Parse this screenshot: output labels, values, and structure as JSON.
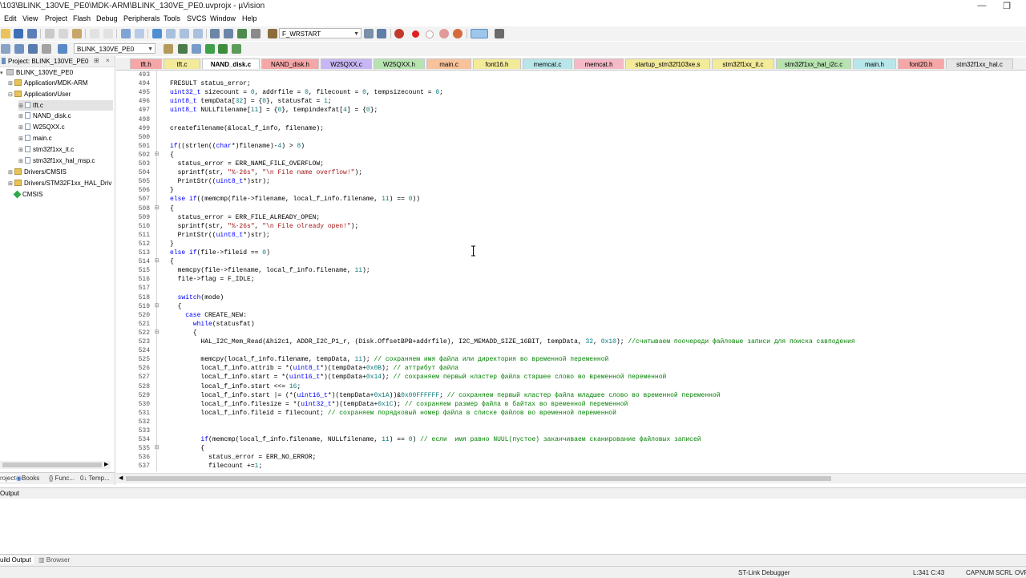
{
  "window": {
    "title": "\\103\\BLINK_130VE_PE0\\MDK-ARM\\BLINK_130VE_PE0.uvprojx - µVision",
    "minimize_glyph": "—",
    "restore_glyph": "❐"
  },
  "menu": [
    "Edit",
    "View",
    "Project",
    "Flash",
    "Debug",
    "Peripherals",
    "Tools",
    "SVCS",
    "Window",
    "Help"
  ],
  "toolbar": {
    "function_combo": "F_WRSTART",
    "target_combo": "BLINK_130VE_PE0"
  },
  "project": {
    "header": "Project: BLINK_130VE_PE0",
    "tree": [
      {
        "label": "BLINK_130VE_PE0",
        "level": 0,
        "type": "target",
        "expander": "▾"
      },
      {
        "label": "Application/MDK-ARM",
        "level": 1,
        "type": "folder",
        "expander": "⊞"
      },
      {
        "label": "Application/User",
        "level": 1,
        "type": "folder",
        "expander": "⊟"
      },
      {
        "label": "tft.c",
        "level": 2,
        "type": "file",
        "expander": "⊞"
      },
      {
        "label": "NAND_disk.c",
        "level": 2,
        "type": "file",
        "expander": "⊞"
      },
      {
        "label": "W25QXX.c",
        "level": 2,
        "type": "file",
        "expander": "⊞"
      },
      {
        "label": "main.c",
        "level": 2,
        "type": "file",
        "expander": "⊞"
      },
      {
        "label": "stm32f1xx_it.c",
        "level": 2,
        "type": "file",
        "expander": "⊞"
      },
      {
        "label": "stm32f1xx_hal_msp.c",
        "level": 2,
        "type": "file",
        "expander": "⊞"
      },
      {
        "label": "Drivers/CMSIS",
        "level": 1,
        "type": "folder",
        "expander": "⊞"
      },
      {
        "label": "Drivers/STM32F1xx_HAL_Driv",
        "level": 1,
        "type": "folder",
        "expander": "⊞"
      },
      {
        "label": "CMSIS",
        "level": 1,
        "type": "diamond",
        "expander": ""
      }
    ],
    "panel_tabs": [
      "roject",
      "Books",
      "{} Func...",
      "0↓ Temp..."
    ]
  },
  "editor_tabs": [
    {
      "label": "tft.h",
      "color": "#f5a6a6",
      "active": false
    },
    {
      "label": "tft.c",
      "color": "#f3ea9a",
      "active": false
    },
    {
      "label": "NAND_disk.c",
      "color": "#f3ea9a",
      "active": true
    },
    {
      "label": "NAND_disk.h",
      "color": "#f5a6a6",
      "active": false
    },
    {
      "label": "W25QXX.c",
      "color": "#c7b6f3",
      "active": false
    },
    {
      "label": "W25QXX.h",
      "color": "#b7e3b0",
      "active": false
    },
    {
      "label": "main.c",
      "color": "#f8c39a",
      "active": false
    },
    {
      "label": "font16.h",
      "color": "#f3ea9a",
      "active": false
    },
    {
      "label": "memcat.c",
      "color": "#b8e6ea",
      "active": false
    },
    {
      "label": "memcat.h",
      "color": "#f5b9c8",
      "active": false
    },
    {
      "label": "startup_stm32f103xe.s",
      "color": "#f3ea9a",
      "active": false
    },
    {
      "label": "stm32f1xx_it.c",
      "color": "#f3ea9a",
      "active": false
    },
    {
      "label": "stm32f1xx_hal_i2c.c",
      "color": "#b7e3b0",
      "active": false
    },
    {
      "label": "main.h",
      "color": "#b8e6ea",
      "active": false
    },
    {
      "label": "font20.h",
      "color": "#f5a6a6",
      "active": false
    },
    {
      "label": "stm32f1xx_hal.c",
      "color": "#e6e6e6",
      "active": false
    }
  ],
  "code": [
    {
      "n": "493",
      "fold": "",
      "t": ""
    },
    {
      "n": "494",
      "fold": "",
      "t": "FRESULT status_error;"
    },
    {
      "n": "495",
      "fold": "",
      "t": "uint32_t sizecount = 0, addrfile = 0, filecount = 0, tempsizecount = 0;"
    },
    {
      "n": "496",
      "fold": "",
      "t": "uint8_t tempData[32] = {0}, statusfat = 1;"
    },
    {
      "n": "497",
      "fold": "",
      "t": "uint8_t NULLfilename[11] = {0}, tempindexfat[4] = {0};"
    },
    {
      "n": "498",
      "fold": "",
      "t": ""
    },
    {
      "n": "499",
      "fold": "",
      "t": "createfilename(&local_f_info, filename);"
    },
    {
      "n": "500",
      "fold": "",
      "t": ""
    },
    {
      "n": "501",
      "fold": "",
      "t": "if((strlen((char*)filename)-4) > 8)"
    },
    {
      "n": "502",
      "fold": "⊟",
      "t": "{"
    },
    {
      "n": "503",
      "fold": "",
      "t": "  status_error = ERR_NAME_FILE_OVERFLOW;"
    },
    {
      "n": "504",
      "fold": "",
      "t": "  sprintf(str, \"%-26s\", \"\\n File name overflow!\");"
    },
    {
      "n": "505",
      "fold": "",
      "t": "  PrintStr((uint8_t*)str);"
    },
    {
      "n": "506",
      "fold": "",
      "t": "}"
    },
    {
      "n": "507",
      "fold": "",
      "t": "else if((memcmp(file->filename, local_f_info.filename, 11) == 0))"
    },
    {
      "n": "508",
      "fold": "⊟",
      "t": "{"
    },
    {
      "n": "509",
      "fold": "",
      "t": "  status_error = ERR_FILE_ALREADY_OPEN;"
    },
    {
      "n": "510",
      "fold": "",
      "t": "  sprintf(str, \"%-26s\", \"\\n File olready open!\");"
    },
    {
      "n": "511",
      "fold": "",
      "t": "  PrintStr((uint8_t*)str);"
    },
    {
      "n": "512",
      "fold": "",
      "t": "}"
    },
    {
      "n": "513",
      "fold": "",
      "t": "else if(file->fileid == 0)"
    },
    {
      "n": "514",
      "fold": "⊟",
      "t": "{"
    },
    {
      "n": "515",
      "fold": "",
      "t": "  memcpy(file->filename, local_f_info.filename, 11);"
    },
    {
      "n": "516",
      "fold": "",
      "t": "  file->flag = F_IDLE;"
    },
    {
      "n": "517",
      "fold": "",
      "t": ""
    },
    {
      "n": "518",
      "fold": "",
      "t": "  switch(mode)"
    },
    {
      "n": "519",
      "fold": "⊟",
      "t": "  {"
    },
    {
      "n": "520",
      "fold": "",
      "t": "    case CREATE_NEW:"
    },
    {
      "n": "521",
      "fold": "",
      "t": "      while(statusfat)"
    },
    {
      "n": "522",
      "fold": "⊟",
      "t": "      {"
    },
    {
      "n": "523",
      "fold": "",
      "t": "        HAL_I2C_Mem_Read(&hi2c1, ADDR_I2C_P1_r, (Disk.OffsetBPB+addrfile), I2C_MEMADD_SIZE_16BIT, tempData, 32, 0x10); //считываем поочереди файловые записи для поиска савподения"
    },
    {
      "n": "524",
      "fold": "",
      "t": ""
    },
    {
      "n": "525",
      "fold": "",
      "t": "        memcpy(local_f_info.filename, tempData, 11); // сохраняем имя файла или директория во временной переменной"
    },
    {
      "n": "526",
      "fold": "",
      "t": "        local_f_info.attrib = *(uint8_t*)(tempData+0x0B); // аттрибут файла"
    },
    {
      "n": "527",
      "fold": "",
      "t": "        local_f_info.start = *(uint16_t*)(tempData+0x14); // сохраняем первый кластер файла старшее слово во временной переменной"
    },
    {
      "n": "528",
      "fold": "",
      "t": "        local_f_info.start <<= 16;"
    },
    {
      "n": "529",
      "fold": "",
      "t": "        local_f_info.start |= (*(uint16_t*)(tempData+0x1A))&0x00FFFFFF; // сохраняем первый кластер файла младшее слово во временной переменной"
    },
    {
      "n": "530",
      "fold": "",
      "t": "        local_f_info.filesize = *(uint32_t*)(tempData+0x1C); // сохраняем размер файла в байтах во временной переменной"
    },
    {
      "n": "531",
      "fold": "",
      "t": "        local_f_info.fileid = filecount; // сохраняем порядковый номер файла в списке файлов во временной переменной"
    },
    {
      "n": "532",
      "fold": "",
      "t": ""
    },
    {
      "n": "533",
      "fold": "",
      "t": ""
    },
    {
      "n": "534",
      "fold": "",
      "t": "        if(memcmp(local_f_info.filename, NULLfilename, 11) == 0) // если  имя равно NUUL(пустое) заканчиваем сканирование файловых записей"
    },
    {
      "n": "535",
      "fold": "⊟",
      "t": "        {"
    },
    {
      "n": "536",
      "fold": "",
      "t": "          status_error = ERR_NO_ERROR;"
    },
    {
      "n": "537",
      "fold": "",
      "t": "          filecount +=1;"
    }
  ],
  "output": {
    "title": "Output",
    "tabs": [
      "uild Output",
      "Browser"
    ]
  },
  "status": {
    "debugger": "ST-Link Debugger",
    "position": "L:341 C:43",
    "indicators": [
      "CAP",
      "NUM",
      "SCRL",
      "OVR"
    ]
  }
}
